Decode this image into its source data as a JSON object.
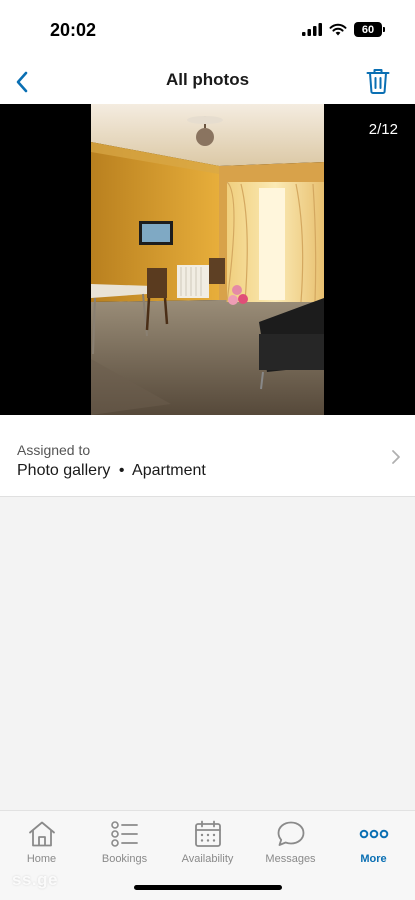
{
  "status": {
    "time": "20:02",
    "battery": "60"
  },
  "nav": {
    "title": "All photos"
  },
  "photo": {
    "counter": "2/12"
  },
  "assigned": {
    "label": "Assigned to",
    "gallery": "Photo gallery",
    "separator": "•",
    "property": "Apartment"
  },
  "tabs": [
    {
      "label": "Home",
      "icon": "home-icon"
    },
    {
      "label": "Bookings",
      "icon": "list-icon"
    },
    {
      "label": "Availability",
      "icon": "calendar-icon"
    },
    {
      "label": "Messages",
      "icon": "chat-bubble-icon"
    },
    {
      "label": "More",
      "icon": "more-dots-icon"
    }
  ],
  "watermark": "ss.ge",
  "colors": {
    "accent": "#0a6fb3",
    "inactive": "#8a8a8a"
  }
}
